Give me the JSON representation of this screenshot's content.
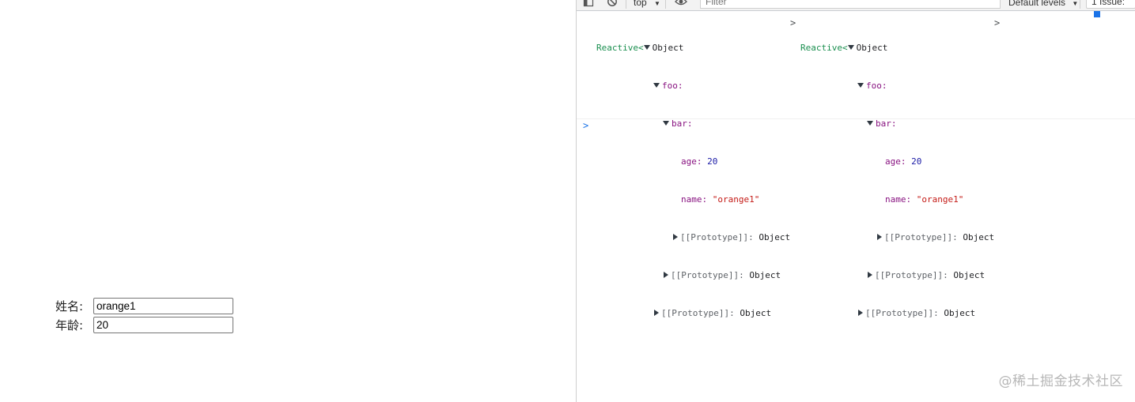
{
  "form": {
    "name_label": "姓名:",
    "name_value": "orange1",
    "age_label": "年龄:",
    "age_value": "20"
  },
  "devtools": {
    "toolbar": {
      "context": "top",
      "filter_placeholder": "Filter",
      "levels": "Default levels",
      "issues": "1 Issue:"
    },
    "logs": [
      {
        "prefix": "Reactive<",
        "root": "Object",
        "foo_key": "foo:",
        "bar_key": "bar:",
        "age_key": "age:",
        "age_value": "20",
        "name_key": "name:",
        "name_value": "\"orange1\"",
        "proto_label": "[[Prototype]]:",
        "proto_value": "Object",
        "close": ">"
      },
      {
        "prefix": "Reactive<",
        "root": "Object",
        "foo_key": "foo:",
        "bar_key": "bar:",
        "age_key": "age:",
        "age_value": "20",
        "name_key": "name:",
        "name_value": "\"orange1\"",
        "proto_label": "[[Prototype]]:",
        "proto_value": "Object",
        "close": ">"
      }
    ],
    "prompt": ">"
  },
  "watermark": "@稀土掘金技术社区"
}
